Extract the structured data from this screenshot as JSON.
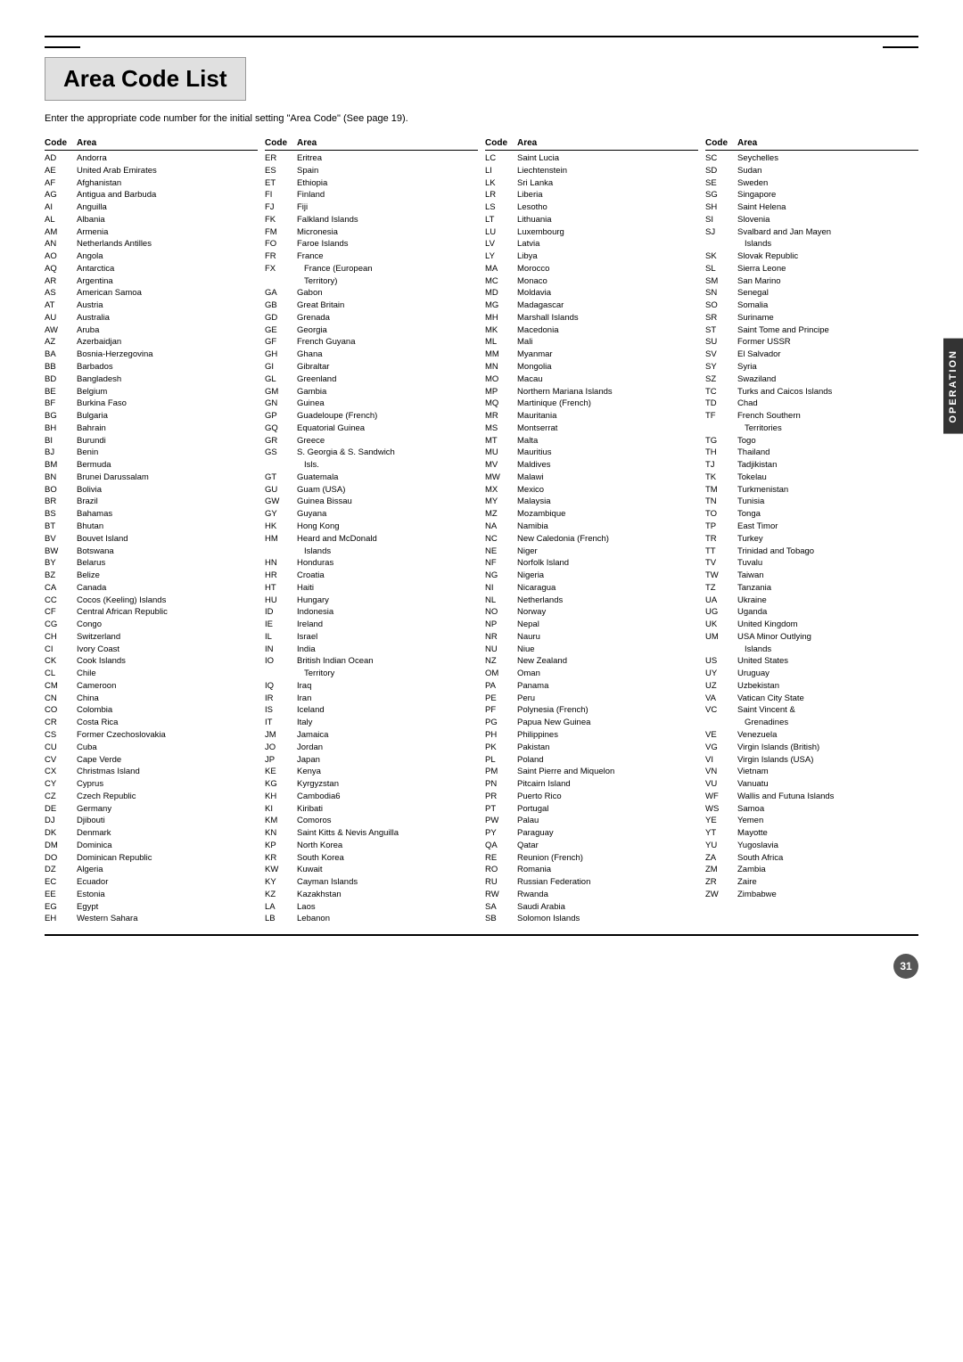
{
  "page": {
    "title": "Area Code List",
    "subtitle": "Enter the appropriate code number for the initial setting \"Area Code\" (See page 19).",
    "page_number": "31",
    "side_tab": "OPERATION"
  },
  "columns": [
    {
      "header_code": "Code",
      "header_area": "Area",
      "entries": [
        {
          "code": "AD",
          "area": "Andorra"
        },
        {
          "code": "AE",
          "area": "United Arab Emirates"
        },
        {
          "code": "AF",
          "area": "Afghanistan"
        },
        {
          "code": "AG",
          "area": "Antigua and Barbuda"
        },
        {
          "code": "AI",
          "area": "Anguilla"
        },
        {
          "code": "AL",
          "area": "Albania"
        },
        {
          "code": "AM",
          "area": "Armenia"
        },
        {
          "code": "AN",
          "area": "Netherlands Antilles"
        },
        {
          "code": "AO",
          "area": "Angola"
        },
        {
          "code": "AQ",
          "area": "Antarctica"
        },
        {
          "code": "AR",
          "area": "Argentina"
        },
        {
          "code": "AS",
          "area": "American Samoa"
        },
        {
          "code": "AT",
          "area": "Austria"
        },
        {
          "code": "AU",
          "area": "Australia"
        },
        {
          "code": "AW",
          "area": "Aruba"
        },
        {
          "code": "AZ",
          "area": "Azerbaidjan"
        },
        {
          "code": "BA",
          "area": "Bosnia-Herzegovina"
        },
        {
          "code": "BB",
          "area": "Barbados"
        },
        {
          "code": "BD",
          "area": "Bangladesh"
        },
        {
          "code": "BE",
          "area": "Belgium"
        },
        {
          "code": "BF",
          "area": "Burkina Faso"
        },
        {
          "code": "BG",
          "area": "Bulgaria"
        },
        {
          "code": "BH",
          "area": "Bahrain"
        },
        {
          "code": "BI",
          "area": "Burundi"
        },
        {
          "code": "BJ",
          "area": "Benin"
        },
        {
          "code": "BM",
          "area": "Bermuda"
        },
        {
          "code": "BN",
          "area": "Brunei Darussalam"
        },
        {
          "code": "BO",
          "area": "Bolivia"
        },
        {
          "code": "BR",
          "area": "Brazil"
        },
        {
          "code": "BS",
          "area": "Bahamas"
        },
        {
          "code": "BT",
          "area": "Bhutan"
        },
        {
          "code": "BV",
          "area": "Bouvet Island"
        },
        {
          "code": "BW",
          "area": "Botswana"
        },
        {
          "code": "BY",
          "area": "Belarus"
        },
        {
          "code": "BZ",
          "area": "Belize"
        },
        {
          "code": "CA",
          "area": "Canada"
        },
        {
          "code": "CC",
          "area": "Cocos (Keeling) Islands"
        },
        {
          "code": "CF",
          "area": "Central African Republic"
        },
        {
          "code": "CG",
          "area": "Congo"
        },
        {
          "code": "CH",
          "area": "Switzerland"
        },
        {
          "code": "CI",
          "area": "Ivory Coast"
        },
        {
          "code": "CK",
          "area": "Cook Islands"
        },
        {
          "code": "CL",
          "area": "Chile"
        },
        {
          "code": "CM",
          "area": "Cameroon"
        },
        {
          "code": "CN",
          "area": "China"
        },
        {
          "code": "CO",
          "area": "Colombia"
        },
        {
          "code": "CR",
          "area": "Costa Rica"
        },
        {
          "code": "CS",
          "area": "Former Czechoslovakia"
        },
        {
          "code": "CU",
          "area": "Cuba"
        },
        {
          "code": "CV",
          "area": "Cape Verde"
        },
        {
          "code": "CX",
          "area": "Christmas Island"
        },
        {
          "code": "CY",
          "area": "Cyprus"
        },
        {
          "code": "CZ",
          "area": "Czech Republic"
        },
        {
          "code": "DE",
          "area": "Germany"
        },
        {
          "code": "DJ",
          "area": "Djibouti"
        },
        {
          "code": "DK",
          "area": "Denmark"
        },
        {
          "code": "DM",
          "area": "Dominica"
        },
        {
          "code": "DO",
          "area": "Dominican Republic"
        },
        {
          "code": "DZ",
          "area": "Algeria"
        },
        {
          "code": "EC",
          "area": "Ecuador"
        },
        {
          "code": "EE",
          "area": "Estonia"
        },
        {
          "code": "EG",
          "area": "Egypt"
        },
        {
          "code": "EH",
          "area": "Western Sahara"
        }
      ]
    },
    {
      "header_code": "Code",
      "header_area": "Area",
      "entries": [
        {
          "code": "ER",
          "area": "Eritrea"
        },
        {
          "code": "ES",
          "area": "Spain"
        },
        {
          "code": "ET",
          "area": "Ethiopia"
        },
        {
          "code": "FI",
          "area": "Finland"
        },
        {
          "code": "FJ",
          "area": "Fiji"
        },
        {
          "code": "FK",
          "area": "Falkland Islands"
        },
        {
          "code": "FM",
          "area": "Micronesia"
        },
        {
          "code": "FO",
          "area": "Faroe Islands"
        },
        {
          "code": "FR",
          "area": "France"
        },
        {
          "code": "FX",
          "area": "France (European",
          "indent": true
        },
        {
          "code": "",
          "area": "Territory)",
          "indent": true
        },
        {
          "code": "GA",
          "area": "Gabon"
        },
        {
          "code": "GB",
          "area": "Great Britain"
        },
        {
          "code": "GD",
          "area": "Grenada"
        },
        {
          "code": "GE",
          "area": "Georgia"
        },
        {
          "code": "GF",
          "area": "French Guyana"
        },
        {
          "code": "GH",
          "area": "Ghana"
        },
        {
          "code": "GI",
          "area": "Gibraltar"
        },
        {
          "code": "GL",
          "area": "Greenland"
        },
        {
          "code": "GM",
          "area": "Gambia"
        },
        {
          "code": "GN",
          "area": "Guinea"
        },
        {
          "code": "GP",
          "area": "Guadeloupe (French)"
        },
        {
          "code": "GQ",
          "area": "Equatorial Guinea"
        },
        {
          "code": "GR",
          "area": "Greece"
        },
        {
          "code": "GS",
          "area": "S. Georgia & S. Sandwich",
          "indent": false
        },
        {
          "code": "",
          "area": "Isls.",
          "indent": true
        },
        {
          "code": "GT",
          "area": "Guatemala"
        },
        {
          "code": "GU",
          "area": "Guam (USA)"
        },
        {
          "code": "GW",
          "area": "Guinea Bissau"
        },
        {
          "code": "GY",
          "area": "Guyana"
        },
        {
          "code": "HK",
          "area": "Hong Kong"
        },
        {
          "code": "HM",
          "area": "Heard and McDonald",
          "indent": false
        },
        {
          "code": "",
          "area": "Islands",
          "indent": true
        },
        {
          "code": "HN",
          "area": "Honduras"
        },
        {
          "code": "HR",
          "area": "Croatia"
        },
        {
          "code": "HT",
          "area": "Haiti"
        },
        {
          "code": "HU",
          "area": "Hungary"
        },
        {
          "code": "ID",
          "area": "Indonesia"
        },
        {
          "code": "IE",
          "area": "Ireland"
        },
        {
          "code": "IL",
          "area": "Israel"
        },
        {
          "code": "IN",
          "area": "India"
        },
        {
          "code": "IO",
          "area": "British Indian Ocean",
          "indent": false
        },
        {
          "code": "",
          "area": "Territory",
          "indent": true
        },
        {
          "code": "IQ",
          "area": "Iraq"
        },
        {
          "code": "IR",
          "area": "Iran"
        },
        {
          "code": "IS",
          "area": "Iceland"
        },
        {
          "code": "IT",
          "area": "Italy"
        },
        {
          "code": "JM",
          "area": "Jamaica"
        },
        {
          "code": "JO",
          "area": "Jordan"
        },
        {
          "code": "JP",
          "area": "Japan"
        },
        {
          "code": "KE",
          "area": "Kenya"
        },
        {
          "code": "KG",
          "area": "Kyrgyzstan"
        },
        {
          "code": "KH",
          "area": "Cambodia6"
        },
        {
          "code": "KI",
          "area": "Kiribati"
        },
        {
          "code": "KM",
          "area": "Comoros"
        },
        {
          "code": "KN",
          "area": "Saint Kitts & Nevis Anguilla"
        },
        {
          "code": "KP",
          "area": "North Korea"
        },
        {
          "code": "KR",
          "area": "South Korea"
        },
        {
          "code": "KW",
          "area": "Kuwait"
        },
        {
          "code": "KY",
          "area": "Cayman Islands"
        },
        {
          "code": "KZ",
          "area": "Kazakhstan"
        },
        {
          "code": "LA",
          "area": "Laos"
        },
        {
          "code": "LB",
          "area": "Lebanon"
        }
      ]
    },
    {
      "header_code": "Code",
      "header_area": "Area",
      "entries": [
        {
          "code": "LC",
          "area": "Saint Lucia"
        },
        {
          "code": "LI",
          "area": "Liechtenstein"
        },
        {
          "code": "LK",
          "area": "Sri Lanka"
        },
        {
          "code": "LR",
          "area": "Liberia"
        },
        {
          "code": "LS",
          "area": "Lesotho"
        },
        {
          "code": "LT",
          "area": "Lithuania"
        },
        {
          "code": "LU",
          "area": "Luxembourg"
        },
        {
          "code": "LV",
          "area": "Latvia"
        },
        {
          "code": "LY",
          "area": "Libya"
        },
        {
          "code": "MA",
          "area": "Morocco"
        },
        {
          "code": "MC",
          "area": "Monaco"
        },
        {
          "code": "MD",
          "area": "Moldavia"
        },
        {
          "code": "MG",
          "area": "Madagascar"
        },
        {
          "code": "MH",
          "area": "Marshall Islands"
        },
        {
          "code": "MK",
          "area": "Macedonia"
        },
        {
          "code": "ML",
          "area": "Mali"
        },
        {
          "code": "MM",
          "area": "Myanmar"
        },
        {
          "code": "MN",
          "area": "Mongolia"
        },
        {
          "code": "MO",
          "area": "Macau"
        },
        {
          "code": "MP",
          "area": "Northern Mariana Islands"
        },
        {
          "code": "MQ",
          "area": "Martinique (French)"
        },
        {
          "code": "MR",
          "area": "Mauritania"
        },
        {
          "code": "MS",
          "area": "Montserrat"
        },
        {
          "code": "MT",
          "area": "Malta"
        },
        {
          "code": "MU",
          "area": "Mauritius"
        },
        {
          "code": "MV",
          "area": "Maldives"
        },
        {
          "code": "MW",
          "area": "Malawi"
        },
        {
          "code": "MX",
          "area": "Mexico"
        },
        {
          "code": "MY",
          "area": "Malaysia"
        },
        {
          "code": "MZ",
          "area": "Mozambique"
        },
        {
          "code": "NA",
          "area": "Namibia"
        },
        {
          "code": "NC",
          "area": "New Caledonia (French)"
        },
        {
          "code": "NE",
          "area": "Niger"
        },
        {
          "code": "NF",
          "area": "Norfolk Island"
        },
        {
          "code": "NG",
          "area": "Nigeria"
        },
        {
          "code": "NI",
          "area": "Nicaragua"
        },
        {
          "code": "NL",
          "area": "Netherlands"
        },
        {
          "code": "NO",
          "area": "Norway"
        },
        {
          "code": "NP",
          "area": "Nepal"
        },
        {
          "code": "NR",
          "area": "Nauru"
        },
        {
          "code": "NU",
          "area": "Niue"
        },
        {
          "code": "NZ",
          "area": "New Zealand"
        },
        {
          "code": "OM",
          "area": "Oman"
        },
        {
          "code": "PA",
          "area": "Panama"
        },
        {
          "code": "PE",
          "area": "Peru"
        },
        {
          "code": "PF",
          "area": "Polynesia (French)"
        },
        {
          "code": "PG",
          "area": "Papua New Guinea"
        },
        {
          "code": "PH",
          "area": "Philippines"
        },
        {
          "code": "PK",
          "area": "Pakistan"
        },
        {
          "code": "PL",
          "area": "Poland"
        },
        {
          "code": "PM",
          "area": "Saint Pierre and Miquelon"
        },
        {
          "code": "PN",
          "area": "Pitcairn Island"
        },
        {
          "code": "PR",
          "area": "Puerto Rico"
        },
        {
          "code": "PT",
          "area": "Portugal"
        },
        {
          "code": "PW",
          "area": "Palau"
        },
        {
          "code": "PY",
          "area": "Paraguay"
        },
        {
          "code": "QA",
          "area": "Qatar"
        },
        {
          "code": "RE",
          "area": "Reunion (French)"
        },
        {
          "code": "RO",
          "area": "Romania"
        },
        {
          "code": "RU",
          "area": "Russian Federation"
        },
        {
          "code": "RW",
          "area": "Rwanda"
        },
        {
          "code": "SA",
          "area": "Saudi Arabia"
        },
        {
          "code": "SB",
          "area": "Solomon Islands"
        }
      ]
    },
    {
      "header_code": "Code",
      "header_area": "Area",
      "entries": [
        {
          "code": "SC",
          "area": "Seychelles"
        },
        {
          "code": "SD",
          "area": "Sudan"
        },
        {
          "code": "SE",
          "area": "Sweden"
        },
        {
          "code": "SG",
          "area": "Singapore"
        },
        {
          "code": "SH",
          "area": "Saint Helena"
        },
        {
          "code": "SI",
          "area": "Slovenia"
        },
        {
          "code": "SJ",
          "area": "Svalbard and Jan Mayen",
          "indent": false
        },
        {
          "code": "",
          "area": "Islands",
          "indent": true
        },
        {
          "code": "SK",
          "area": "Slovak Republic"
        },
        {
          "code": "SL",
          "area": "Sierra Leone"
        },
        {
          "code": "SM",
          "area": "San Marino"
        },
        {
          "code": "SN",
          "area": "Senegal"
        },
        {
          "code": "SO",
          "area": "Somalia"
        },
        {
          "code": "SR",
          "area": "Suriname"
        },
        {
          "code": "ST",
          "area": "Saint Tome and Principe"
        },
        {
          "code": "SU",
          "area": "Former USSR"
        },
        {
          "code": "SV",
          "area": "El Salvador"
        },
        {
          "code": "SY",
          "area": "Syria"
        },
        {
          "code": "SZ",
          "area": "Swaziland"
        },
        {
          "code": "TC",
          "area": "Turks and Caicos Islands"
        },
        {
          "code": "TD",
          "area": "Chad"
        },
        {
          "code": "TF",
          "area": "French Southern",
          "indent": false
        },
        {
          "code": "",
          "area": "Territories",
          "indent": true
        },
        {
          "code": "TG",
          "area": "Togo"
        },
        {
          "code": "TH",
          "area": "Thailand"
        },
        {
          "code": "TJ",
          "area": "Tadjikistan"
        },
        {
          "code": "TK",
          "area": "Tokelau"
        },
        {
          "code": "TM",
          "area": "Turkmenistan"
        },
        {
          "code": "TN",
          "area": "Tunisia"
        },
        {
          "code": "TO",
          "area": "Tonga"
        },
        {
          "code": "TP",
          "area": "East Timor"
        },
        {
          "code": "TR",
          "area": "Turkey"
        },
        {
          "code": "TT",
          "area": "Trinidad and Tobago"
        },
        {
          "code": "TV",
          "area": "Tuvalu"
        },
        {
          "code": "TW",
          "area": "Taiwan"
        },
        {
          "code": "TZ",
          "area": "Tanzania"
        },
        {
          "code": "UA",
          "area": "Ukraine"
        },
        {
          "code": "UG",
          "area": "Uganda"
        },
        {
          "code": "UK",
          "area": "United Kingdom"
        },
        {
          "code": "UM",
          "area": "USA Minor Outlying",
          "indent": false
        },
        {
          "code": "",
          "area": "Islands",
          "indent": true
        },
        {
          "code": "US",
          "area": "United States"
        },
        {
          "code": "UY",
          "area": "Uruguay"
        },
        {
          "code": "UZ",
          "area": "Uzbekistan"
        },
        {
          "code": "VA",
          "area": "Vatican City State"
        },
        {
          "code": "VC",
          "area": "Saint Vincent &",
          "indent": false
        },
        {
          "code": "",
          "area": "Grenadines",
          "indent": true
        },
        {
          "code": "VE",
          "area": "Venezuela"
        },
        {
          "code": "VG",
          "area": "Virgin Islands (British)"
        },
        {
          "code": "VI",
          "area": "Virgin Islands (USA)"
        },
        {
          "code": "VN",
          "area": "Vietnam"
        },
        {
          "code": "VU",
          "area": "Vanuatu"
        },
        {
          "code": "WF",
          "area": "Wallis and Futuna Islands"
        },
        {
          "code": "WS",
          "area": "Samoa"
        },
        {
          "code": "YE",
          "area": "Yemen"
        },
        {
          "code": "YT",
          "area": "Mayotte"
        },
        {
          "code": "YU",
          "area": "Yugoslavia"
        },
        {
          "code": "ZA",
          "area": "South Africa"
        },
        {
          "code": "ZM",
          "area": "Zambia"
        },
        {
          "code": "ZR",
          "area": "Zaire"
        },
        {
          "code": "ZW",
          "area": "Zimbabwe"
        }
      ]
    }
  ]
}
